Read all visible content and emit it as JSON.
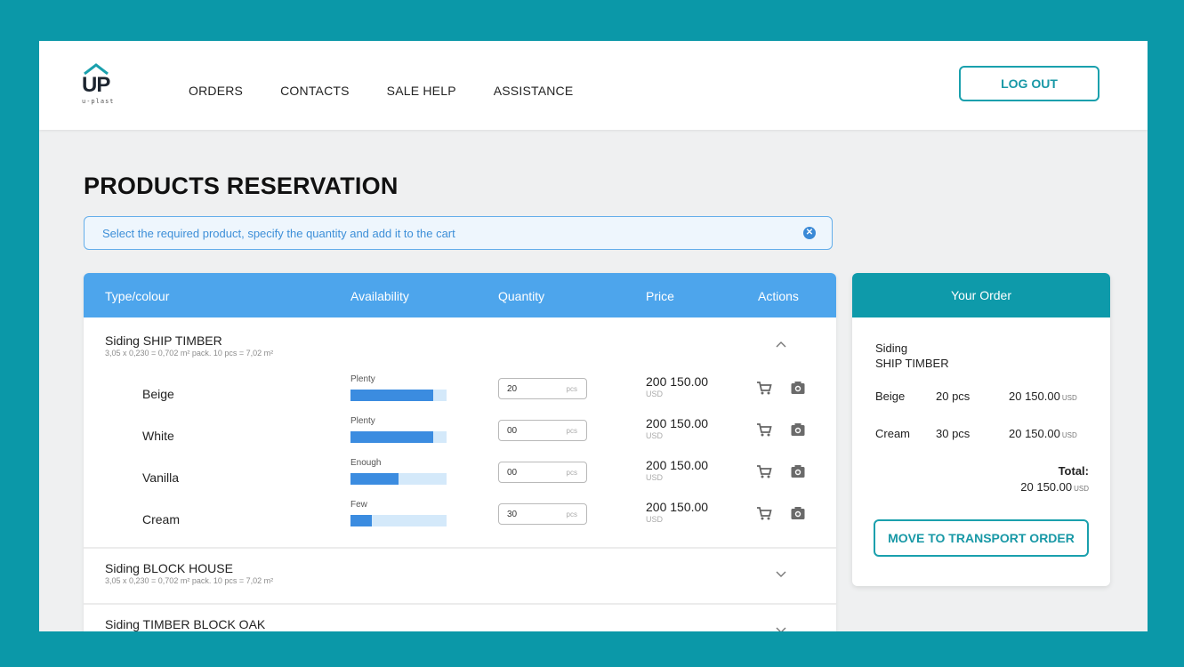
{
  "brand": {
    "logo_text": "UP",
    "logo_sub": "u-plast"
  },
  "nav": {
    "items": [
      {
        "label": "ORDERS"
      },
      {
        "label": "CONTACTS"
      },
      {
        "label": "SALE HELP"
      },
      {
        "label": "ASSISTANCE"
      }
    ],
    "logout_label": "LOG OUT"
  },
  "page": {
    "title": "PRODUCTS RESERVATION",
    "hint": "Select the required product, specify the quantity and add it to the cart"
  },
  "table": {
    "headers": {
      "type": "Type/colour",
      "availability": "Availability",
      "quantity": "Quantity",
      "price": "Price",
      "actions": "Actions"
    },
    "groups": [
      {
        "title": "Siding SHIP TIMBER",
        "sub": "3,05 x 0,230 = 0,702 m² pack. 10 pcs = 7,02 m²",
        "expanded": true,
        "rows": [
          {
            "color": "Beige",
            "availability": "Plenty",
            "availability_level": 0.86,
            "qty": "20",
            "unit": "pcs",
            "price": "200 150.00",
            "currency": "USD"
          },
          {
            "color": "White",
            "availability": "Plenty",
            "availability_level": 0.86,
            "qty": "00",
            "unit": "pcs",
            "price": "200 150.00",
            "currency": "USD"
          },
          {
            "color": "Vanilla",
            "availability": "Enough",
            "availability_level": 0.5,
            "qty": "00",
            "unit": "pcs",
            "price": "200 150.00",
            "currency": "USD"
          },
          {
            "color": "Cream",
            "availability": "Few",
            "availability_level": 0.22,
            "qty": "30",
            "unit": "pcs",
            "price": "200 150.00",
            "currency": "USD"
          }
        ]
      },
      {
        "title": "Siding BLOCK HOUSE",
        "sub": "3,05 x 0,230 = 0,702 m² pack. 10 pcs = 7,02 m²",
        "expanded": false
      },
      {
        "title": "Siding TIMBER BLOCK OAK",
        "expanded": false
      }
    ]
  },
  "order": {
    "title": "Your Order",
    "product_line1": "Siding",
    "product_line2": "SHIP TIMBER",
    "items": [
      {
        "color": "Beige",
        "qty": "20 pcs",
        "amount": "20 150.00",
        "currency": "USD"
      },
      {
        "color": "Cream",
        "qty": "30 pcs",
        "amount": "20 150.00",
        "currency": "USD"
      }
    ],
    "total_label": "Total:",
    "total_amount": "20 150.00",
    "total_currency": "USD",
    "move_button": "MOVE TO TRANSPORT ORDER"
  },
  "colors": {
    "frame": "#0b98a8",
    "table_header": "#4da5ec",
    "order_header": "#0e9aaa",
    "accent": "#1898a6",
    "bar_fill": "#3b8ce0",
    "bar_track": "#d4e9fa"
  },
  "icons": {
    "chevron_up": "chevron-up-icon",
    "chevron_down": "chevron-down-icon",
    "cart": "cart-icon",
    "camera": "camera-icon",
    "close": "close-icon"
  }
}
